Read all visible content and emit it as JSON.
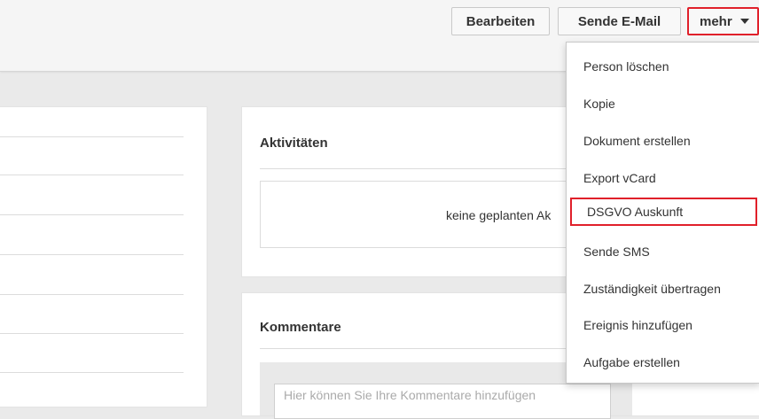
{
  "toolbar": {
    "edit_label": "Bearbeiten",
    "mail_label": "Sende E-Mail",
    "more_label": "mehr"
  },
  "dropdown": {
    "items": [
      {
        "label": "Person löschen"
      },
      {
        "label": "Kopie"
      },
      {
        "label": "Dokument erstellen"
      },
      {
        "label": "Export vCard"
      },
      {
        "label": "DSGVO Auskunft"
      },
      {
        "label": "Sende SMS"
      },
      {
        "label": "Zuständigkeit übertragen"
      },
      {
        "label": "Ereignis hinzufügen"
      },
      {
        "label": "Aufgabe erstellen"
      }
    ]
  },
  "activities": {
    "title": "Aktivitäten",
    "empty_text": "keine geplanten Ak"
  },
  "comments": {
    "title": "Kommentare",
    "placeholder": "Hier können Sie Ihre Kommentare hinzufügen"
  },
  "colors": {
    "highlight": "#e0202a",
    "background": "#eaeaea"
  }
}
